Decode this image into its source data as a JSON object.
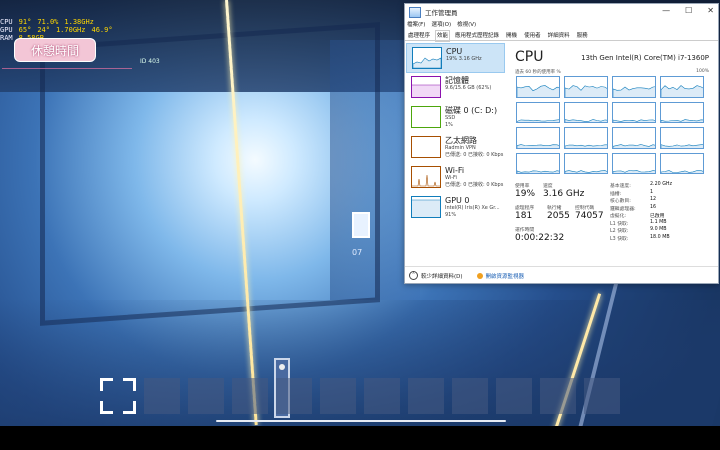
{
  "hud": {
    "rows": [
      [
        "CPU",
        "91°",
        "71.0%",
        "1.38GHz"
      ],
      [
        "GPU",
        "65°",
        "24°",
        "1.70GHz",
        "46.9°"
      ],
      [
        "RAM",
        "8.58GB",
        ""
      ],
      [
        "",
        "999",
        ""
      ]
    ]
  },
  "game": {
    "rest_button": "休憩時間",
    "id_tag": "ID 403",
    "door_sign": "07"
  },
  "taskmgr": {
    "title": "工作管理員",
    "window_buttons": [
      "—",
      "☐",
      "✕"
    ],
    "menu": [
      "檔案(F)",
      "選項(O)",
      "檢視(V)"
    ],
    "tabs": [
      "處理程序",
      "效能",
      "應用程式歷程記錄",
      "開機",
      "使用者",
      "詳細資料",
      "服務"
    ],
    "active_tab": "效能",
    "sidebar": [
      {
        "title": "CPU",
        "lines": [
          "19% 3.16 GHz"
        ],
        "color": "#117dbb"
      },
      {
        "title": "記憶體",
        "lines": [
          "9.6/15.6 GB (62%)"
        ],
        "color": "#8b12ae"
      },
      {
        "title": "磁碟 0 (C: D:)",
        "lines": [
          "SSD",
          "1%"
        ],
        "color": "#4da60c"
      },
      {
        "title": "乙太網路",
        "lines": [
          "Radmin VPN",
          "已傳送: 0 已接收: 0 Kbps"
        ],
        "color": "#a74f01"
      },
      {
        "title": "Wi-Fi",
        "lines": [
          "Wi-Fi",
          "已傳送: 0 已接收: 0 Kbps"
        ],
        "color": "#a74f01"
      },
      {
        "title": "GPU 0",
        "lines": [
          "Intel(R) Iris(R) Xe Gr...",
          "91%"
        ],
        "color": "#117dbb"
      }
    ],
    "main": {
      "heading": "CPU",
      "model": "13th Gen Intel(R) Core(TM) i7-1360P",
      "graph_label": "過去 60 秒的使用率 %",
      "graph_max": "100%",
      "stats": [
        {
          "label": "使用率",
          "value": "19%"
        },
        {
          "label": "速度",
          "value": "3.16 GHz"
        },
        {
          "label": "處理程序",
          "value": "181"
        },
        {
          "label": "執行緒",
          "value": "2055"
        },
        {
          "label": "控制代碼",
          "value": "74057"
        },
        {
          "label": "運作時間",
          "value": "0:00:22:32"
        }
      ],
      "specs": [
        {
          "k": "基本速度:",
          "v": "2.20 GHz"
        },
        {
          "k": "插槽:",
          "v": "1"
        },
        {
          "k": "核心數目:",
          "v": "12"
        },
        {
          "k": "邏輯處理器:",
          "v": "16"
        },
        {
          "k": "虛擬化:",
          "v": "已啟用"
        },
        {
          "k": "L1 快取:",
          "v": "1.1 MB"
        },
        {
          "k": "L2 快取:",
          "v": "9.0 MB"
        },
        {
          "k": "L3 快取:",
          "v": "18.0 MB"
        }
      ]
    },
    "footer": {
      "less_details": "較少詳細資料(D)",
      "open_monitor": "開啟資源監視器"
    }
  },
  "hotbar": {
    "slots": 12,
    "selected_index": 0
  }
}
